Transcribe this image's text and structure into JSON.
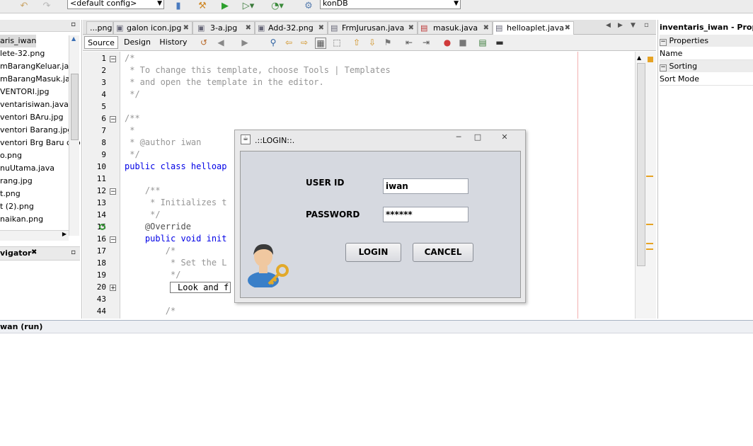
{
  "toolbar": {
    "config_combo": "<default config>",
    "db_combo": "konDB"
  },
  "project_panel": {
    "title": "aris_iwan",
    "files": [
      "lete-32.png",
      "mBarangKeluar.java",
      "mBarangMasuk.java",
      "VENTORI.jpg",
      "ventarisiwan.java",
      "ventori BAru.jpg",
      "ventori Barang.jpg",
      "ventori Brg Baru cop",
      "o.png",
      "nuUtama.java",
      "rang.jpg",
      "t.png",
      "t (2).png",
      "naikan.png"
    ],
    "navigator_title": "vigator"
  },
  "editor": {
    "tabs": [
      {
        "label": "...png",
        "active": false
      },
      {
        "label": "galon icon.jpg",
        "active": false
      },
      {
        "label": "3-a.jpg",
        "active": false
      },
      {
        "label": "Add-32.png",
        "active": false
      },
      {
        "label": "FrmJurusan.java",
        "active": false
      },
      {
        "label": "masuk.java",
        "active": false
      },
      {
        "label": "helloaplet.java",
        "active": true
      }
    ],
    "subtabs": [
      "Source",
      "Design",
      "History"
    ],
    "line_numbers": [
      "1",
      "2",
      "3",
      "4",
      "5",
      "6",
      "7",
      "8",
      "9",
      "10",
      "11",
      "12",
      "13",
      "14",
      "15",
      "16",
      "17",
      "18",
      "19",
      "20",
      "43",
      "44"
    ],
    "code_lines": [
      "/*",
      " * To change this template, choose Tools | Templates",
      " * and open the template in the editor.",
      " */",
      "",
      "/**",
      " *",
      " * @author iwan",
      " */",
      "public class helloap",
      "",
      "    /**",
      "     * Initializes t",
      "     */",
      "    @Override",
      "    public void init",
      "        /*",
      "         * Set the L",
      "         */",
      "        Look and f",
      "",
      "        /*"
    ]
  },
  "properties_panel": {
    "title": "inventaris_iwan - Prope",
    "section_properties": "Properties",
    "name_label": "Name",
    "section_sorting": "Sorting",
    "sort_mode_label": "Sort Mode"
  },
  "output": {
    "title": "wan (run)"
  },
  "login_dialog": {
    "title": ".::LOGIN::.",
    "user_id_label": "USER ID",
    "user_id_value": "iwan",
    "password_label": "PASSWORD",
    "password_value": "******",
    "login_button": "LOGIN",
    "cancel_button": "CANCEL"
  }
}
